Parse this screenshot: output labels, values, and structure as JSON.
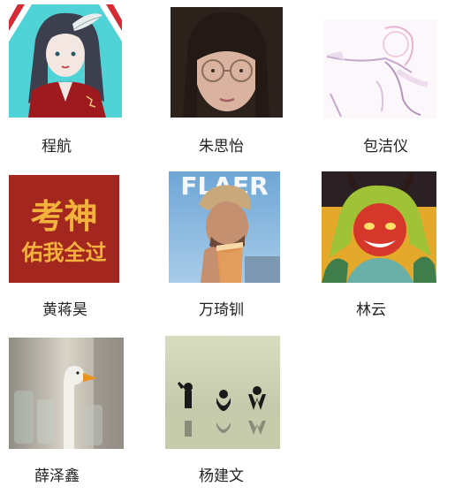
{
  "contacts": [
    {
      "name": "程航",
      "avatar": "avatar-anime-girl-red-kimono"
    },
    {
      "name": "朱思怡",
      "avatar": "avatar-photo-girl-glasses"
    },
    {
      "name": "包洁仪",
      "avatar": "avatar-pastel-sketch"
    },
    {
      "name": "黄蒋昊",
      "avatar": "avatar-text-poster"
    },
    {
      "name": "万琦钏",
      "avatar": "avatar-magazine-cover-man"
    },
    {
      "name": "林云",
      "avatar": "avatar-demon-illustration"
    },
    {
      "name": "薛泽鑫",
      "avatar": "avatar-goose-photo"
    },
    {
      "name": "杨建文",
      "avatar": "avatar-dancing-letters"
    }
  ],
  "poster": {
    "line1": "考神",
    "line2": "佑我全过"
  },
  "magazine": {
    "title": "FLAER"
  },
  "colors": {
    "text": "#222222",
    "poster_red": "#a3271f",
    "poster_yellow": "#f3b23c"
  }
}
